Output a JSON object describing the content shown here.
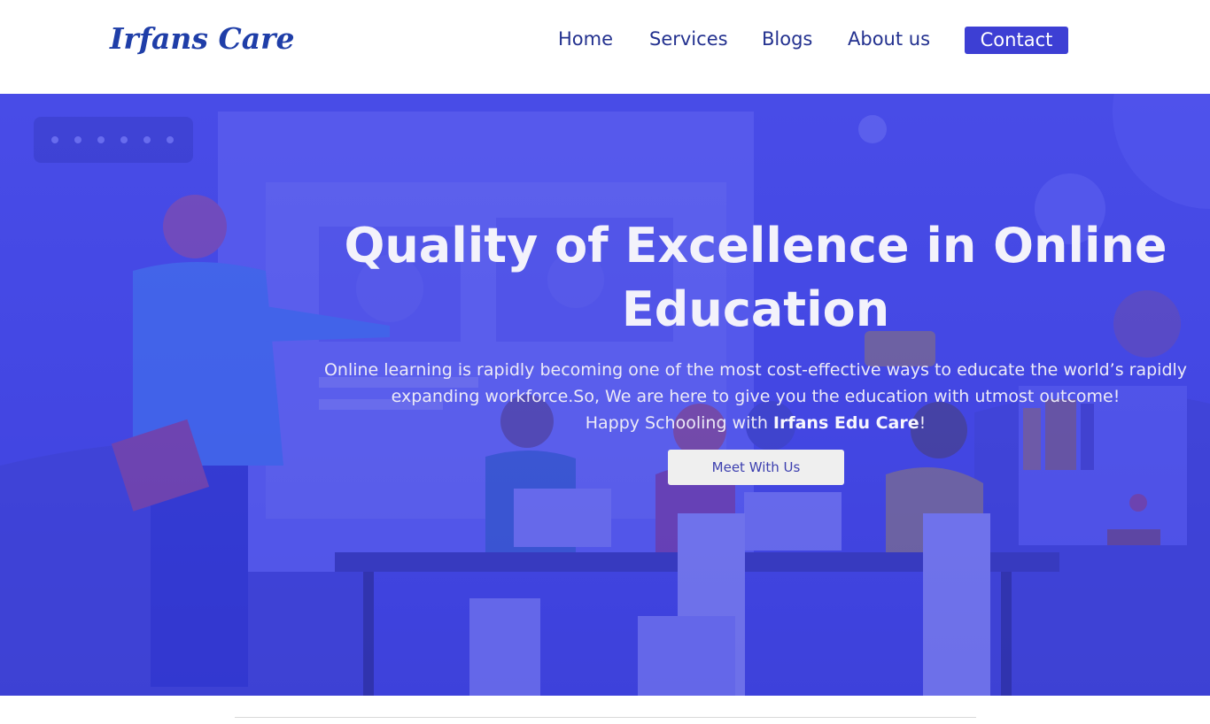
{
  "brand": {
    "name": "Irfans Care"
  },
  "nav": {
    "items": [
      {
        "label": "Home"
      },
      {
        "label": "Services"
      },
      {
        "label": "Blogs"
      },
      {
        "label": "About us"
      }
    ],
    "contact_label": "Contact"
  },
  "hero": {
    "title": "Quality of Excellence in Online Education",
    "description_line1": "Online learning is rapidly becoming one of the most cost-effective ways to educate the world’s rapidly expanding workforce.So, We are here to give you the education with utmost outcome!",
    "tagline_prefix": "Happy Schooling with ",
    "tagline_brand": "Irfans Edu Care",
    "tagline_suffix": "!",
    "cta_label": "Meet With Us"
  },
  "colors": {
    "brand": "#1f3ea8",
    "nav_text": "#23318f",
    "accent": "#3d3fd4",
    "hero_bg": "#4a4ee6",
    "cta_bg": "#efefef",
    "cta_text": "#3c3faf"
  }
}
